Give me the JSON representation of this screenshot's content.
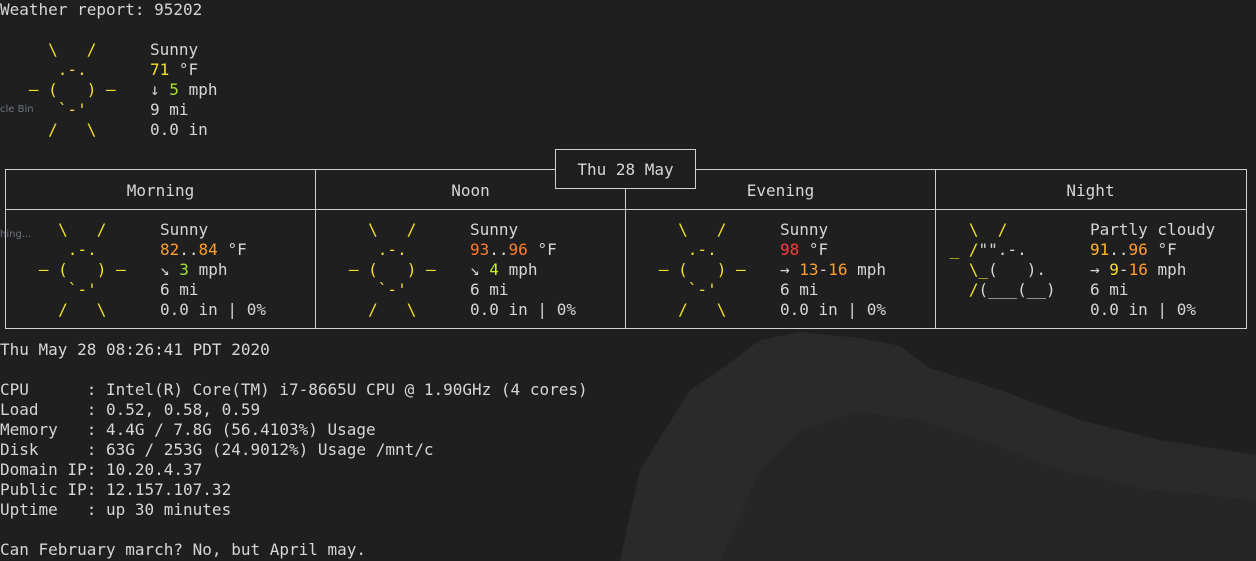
{
  "title": "Weather report: 95202",
  "current": {
    "condition": "Sunny",
    "temp": "71",
    "temp_unit": "°F",
    "wind_arrow": "↓",
    "wind": "5",
    "wind_unit": "mph",
    "visibility": "9 mi",
    "precip": "0.0 in"
  },
  "forecast": {
    "date": "Thu 28 May",
    "periods": [
      {
        "name": "Morning",
        "condition": "Sunny",
        "temp_low": "82",
        "temp_sep": "..",
        "temp_high": "84",
        "temp_unit": "°F",
        "wind_arrow": "↘",
        "wind_low": "3",
        "wind_sep": "",
        "wind_high": "",
        "wind_unit": "mph",
        "visibility": "6 mi",
        "precip": "0.0 in | 0%"
      },
      {
        "name": "Noon",
        "condition": "Sunny",
        "temp_low": "93",
        "temp_sep": "..",
        "temp_high": "96",
        "temp_unit": "°F",
        "wind_arrow": "↘",
        "wind_low": "4",
        "wind_sep": "",
        "wind_high": "",
        "wind_unit": "mph",
        "visibility": "6 mi",
        "precip": "0.0 in | 0%"
      },
      {
        "name": "Evening",
        "condition": "Sunny",
        "temp_low": "98",
        "temp_sep": "",
        "temp_high": "",
        "temp_unit": "°F",
        "wind_arrow": "→",
        "wind_low": "13",
        "wind_sep": "-",
        "wind_high": "16",
        "wind_unit": "mph",
        "visibility": "6 mi",
        "precip": "0.0 in | 0%"
      },
      {
        "name": "Night",
        "condition": "Partly cloudy",
        "temp_low": "91",
        "temp_sep": "..",
        "temp_high": "96",
        "temp_unit": "°F",
        "wind_arrow": "→",
        "wind_low": "9",
        "wind_sep": "-",
        "wind_high": "16",
        "wind_unit": "mph",
        "visibility": "6 mi",
        "precip": "0.0 in | 0%"
      }
    ]
  },
  "datetime": "Thu May 28 08:26:41 PDT 2020",
  "system": [
    {
      "label": "CPU      ",
      "value": "Intel(R) Core(TM) i7-8665U CPU @ 1.90GHz (4 cores)"
    },
    {
      "label": "Load     ",
      "value": "0.52, 0.58, 0.59"
    },
    {
      "label": "Memory   ",
      "value": "4.4G / 7.8G (56.4103%) Usage"
    },
    {
      "label": "Disk     ",
      "value": "63G / 253G (24.9012%) Usage /mnt/c"
    },
    {
      "label": "Domain IP",
      "value": "10.20.4.37"
    },
    {
      "label": "Public IP",
      "value": "12.157.107.32"
    },
    {
      "label": "Uptime   ",
      "value": "up 30 minutes"
    }
  ],
  "fortune": "Can February march? No, but April may.",
  "desktop_ghosts": [
    "cle Bin",
    "hing..."
  ],
  "colors": {
    "background": "#1e1e1e",
    "text": "#d6d6d6",
    "sun": "#f4e02a",
    "temp_warm": "#f4e02a",
    "temp_hot": "#ff9e2c",
    "temp_very_hot": "#ff3a3a",
    "wind_low": "#a6e22e"
  },
  "icons": {
    "sunny": "sun-ascii-icon",
    "partly_cloudy": "partly-cloudy-ascii-icon"
  }
}
